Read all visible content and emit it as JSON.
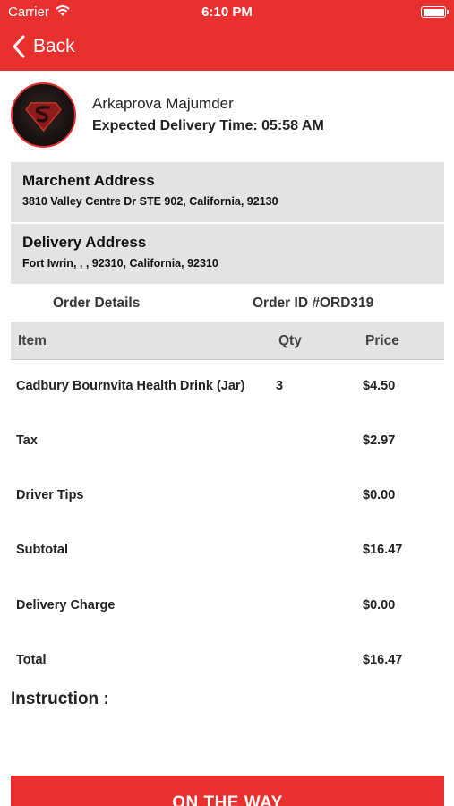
{
  "status_bar": {
    "carrier": "Carrier",
    "time": "6:10 PM",
    "battery_level": 1.0
  },
  "nav": {
    "back_label": "Back"
  },
  "profile": {
    "name": "Arkaprova Majumder",
    "expected_delivery": "Expected Delivery Time: 05:58 AM"
  },
  "merchant": {
    "title": "Marchent Address",
    "address": "3810 Valley Centre Dr STE 902, California, 92130"
  },
  "delivery": {
    "title": "Delivery Address",
    "address": "Fort Iwrin, , , 92310, California, 92310"
  },
  "order": {
    "details_label": "Order Details",
    "order_id": "Order ID #ORD319"
  },
  "table": {
    "headers": {
      "item": "Item",
      "qty": "Qty",
      "price": "Price"
    },
    "rows": [
      {
        "item": "Cadbury Bournvita Health Drink (Jar)",
        "qty": "3",
        "price": "$4.50"
      },
      {
        "item": "Tax",
        "qty": "",
        "price": "$2.97"
      },
      {
        "item": "Driver Tips",
        "qty": "",
        "price": "$0.00"
      },
      {
        "item": "Subtotal",
        "qty": "",
        "price": "$16.47"
      },
      {
        "item": "Delivery Charge",
        "qty": "",
        "price": "$0.00"
      },
      {
        "item": "Total",
        "qty": "",
        "price": "$16.47"
      }
    ]
  },
  "instruction_label": "Instruction :",
  "action_button": "ON THE WAY",
  "colors": {
    "accent": "#e8302f",
    "panel": "#e3e3e3"
  },
  "icons": {
    "back": "chevron-left-icon",
    "wifi": "wifi-icon",
    "battery": "battery-icon"
  }
}
